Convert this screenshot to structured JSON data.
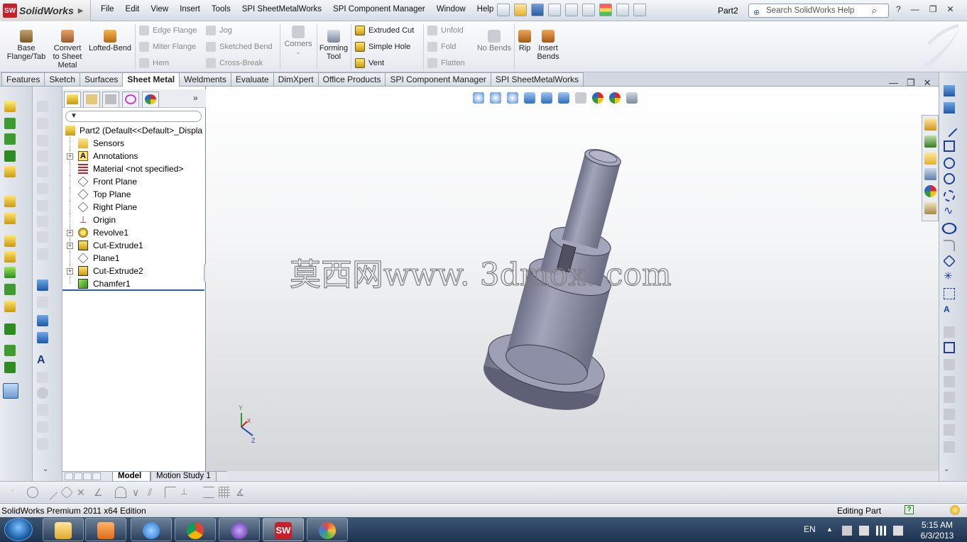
{
  "app": {
    "name": "SolidWorks",
    "logo_text": "SW"
  },
  "menu": [
    "File",
    "Edit",
    "View",
    "Insert",
    "Tools",
    "SPI SheetMetalWorks",
    "SPI Component Manager",
    "Window",
    "Help"
  ],
  "document": {
    "name": "Part2"
  },
  "search": {
    "placeholder": "Search SolidWorks Help"
  },
  "command_manager": {
    "large_buttons": [
      {
        "label": "Base\nFlange/Tab"
      },
      {
        "label": "Convert\nto Sheet\nMetal"
      },
      {
        "label": "Lofted-Bend"
      },
      {
        "label": "Corners"
      },
      {
        "label": "Forming\nTool"
      },
      {
        "label": "No Bends"
      },
      {
        "label": "Rip"
      },
      {
        "label": "Insert\nBends"
      }
    ],
    "small_buttons": [
      {
        "label": "Edge Flange"
      },
      {
        "label": "Miter Flange"
      },
      {
        "label": "Hem"
      },
      {
        "label": "Jog"
      },
      {
        "label": "Sketched Bend"
      },
      {
        "label": "Cross-Break"
      },
      {
        "label": "Extruded Cut"
      },
      {
        "label": "Simple Hole"
      },
      {
        "label": "Vent"
      },
      {
        "label": "Unfold"
      },
      {
        "label": "Fold"
      },
      {
        "label": "Flatten"
      }
    ]
  },
  "tabs": [
    "Features",
    "Sketch",
    "Surfaces",
    "Sheet Metal",
    "Weldments",
    "Evaluate",
    "DimXpert",
    "Office Products",
    "SPI Component Manager",
    "SPI SheetMetalWorks"
  ],
  "active_tab": "Sheet Metal",
  "feature_tree": {
    "root": "Part2  (Default<<Default>_Displa",
    "items": [
      {
        "label": "Sensors",
        "expandable": false
      },
      {
        "label": "Annotations",
        "expandable": true
      },
      {
        "label": "Material <not specified>",
        "expandable": false
      },
      {
        "label": "Front Plane",
        "expandable": false
      },
      {
        "label": "Top Plane",
        "expandable": false
      },
      {
        "label": "Right Plane",
        "expandable": false
      },
      {
        "label": "Origin",
        "expandable": false
      },
      {
        "label": "Revolve1",
        "expandable": true
      },
      {
        "label": "Cut-Extrude1",
        "expandable": true
      },
      {
        "label": "Plane1",
        "expandable": false
      },
      {
        "label": "Cut-Extrude2",
        "expandable": true
      },
      {
        "label": "Chamfer1",
        "expandable": false
      }
    ]
  },
  "bottom_tabs": [
    "Model",
    "Motion Study 1"
  ],
  "watermark": "莫西网www. 3dmox. com",
  "triad": {
    "y": "Y",
    "x": "X",
    "z": "Z"
  },
  "status": {
    "edition": "SolidWorks Premium 2011 x64 Edition",
    "mode": "Editing Part"
  },
  "taskbar": {
    "language": "EN",
    "time": "5:15 AM",
    "date": "6/3/2013"
  },
  "colors": {
    "part_fill": "#8d8fa6",
    "accent": "#c8202a"
  }
}
